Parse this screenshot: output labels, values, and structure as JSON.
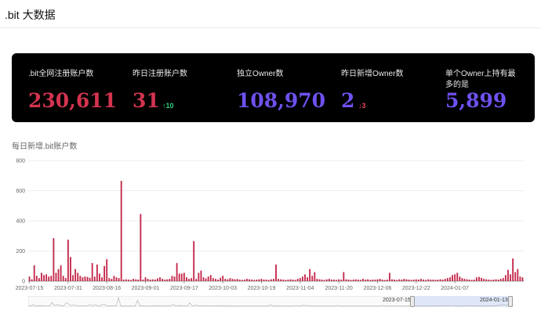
{
  "app_title": ".bit 大数据",
  "stats": [
    {
      "label": ".bit全网注册账户数",
      "value": "230,611",
      "color": "#d3344f"
    },
    {
      "label": "昨日注册账户数",
      "value": "31",
      "color": "#d3344f",
      "delta": "10",
      "delta_dir": "up",
      "delta_color": "#2fd07e"
    },
    {
      "label": "独立Owner数",
      "value": "108,970",
      "color": "#6f51f0"
    },
    {
      "label": "昨日新增Owner数",
      "value": "2",
      "color": "#6f51f0",
      "delta": "3",
      "delta_dir": "down",
      "delta_color": "#e9435f"
    },
    {
      "label": "单个Owner上持有最多的是",
      "value": "5,899",
      "color": "#6f51f0"
    }
  ],
  "chart_title": "每日新增.bit账户数",
  "chart_data": {
    "type": "bar",
    "color": "#c4274a",
    "x_start": "2023-07-15",
    "x_end": "2024-01-13",
    "ylim": [
      0,
      800
    ],
    "y_ticks": [
      "0",
      "200",
      "400",
      "600",
      "800"
    ],
    "x_ticks": [
      "2023-07-15",
      "2023-07-31",
      "2023-08-16",
      "2023-09-01",
      "2023-09-17",
      "2023-10-03",
      "2023-10-19",
      "2023-11-04",
      "2023-11-20",
      "2023-12-06",
      "2023-12-22",
      "2024-01-07"
    ],
    "values": [
      30,
      12,
      105,
      35,
      20,
      55,
      40,
      45,
      30,
      35,
      285,
      55,
      80,
      105,
      35,
      20,
      275,
      160,
      40,
      80,
      55,
      35,
      25,
      30,
      28,
      22,
      120,
      30,
      110,
      50,
      25,
      100,
      145,
      20,
      15,
      35,
      25,
      20,
      665,
      10,
      12,
      10,
      8,
      15,
      12,
      10,
      445,
      10,
      25,
      15,
      10,
      12,
      10,
      18,
      25,
      15,
      10,
      12,
      15,
      35,
      30,
      120,
      50,
      50,
      55,
      25,
      15,
      20,
      265,
      15,
      55,
      70,
      25,
      18,
      30,
      40,
      20,
      15,
      10,
      22,
      35,
      15,
      12,
      20,
      15,
      12,
      14,
      10,
      8,
      10,
      15,
      12,
      10,
      8,
      10,
      12,
      15,
      10,
      10,
      8,
      12,
      15,
      110,
      15,
      12,
      10,
      8,
      10,
      12,
      10,
      8,
      15,
      20,
      30,
      45,
      25,
      80,
      35,
      60,
      15,
      12,
      10,
      8,
      12,
      15,
      10,
      10,
      8,
      12,
      10,
      60,
      12,
      10,
      8,
      10,
      12,
      10,
      8,
      15,
      10,
      12,
      8,
      10,
      10,
      12,
      15,
      10,
      8,
      10,
      55,
      12,
      10,
      8,
      12,
      10,
      15,
      12,
      10,
      8,
      10,
      12,
      10,
      15,
      10,
      8,
      12,
      10,
      10,
      8,
      10,
      12,
      10,
      15,
      20,
      25,
      40,
      45,
      55,
      30,
      20,
      15,
      12,
      10,
      8,
      10,
      25,
      28,
      22,
      15,
      12,
      10,
      8,
      10,
      12,
      10,
      15,
      20,
      40,
      75,
      45,
      150,
      60,
      80,
      30,
      25
    ]
  },
  "zoom": {
    "start_label": "2023-07-15",
    "end_label": "2024-01-13"
  }
}
